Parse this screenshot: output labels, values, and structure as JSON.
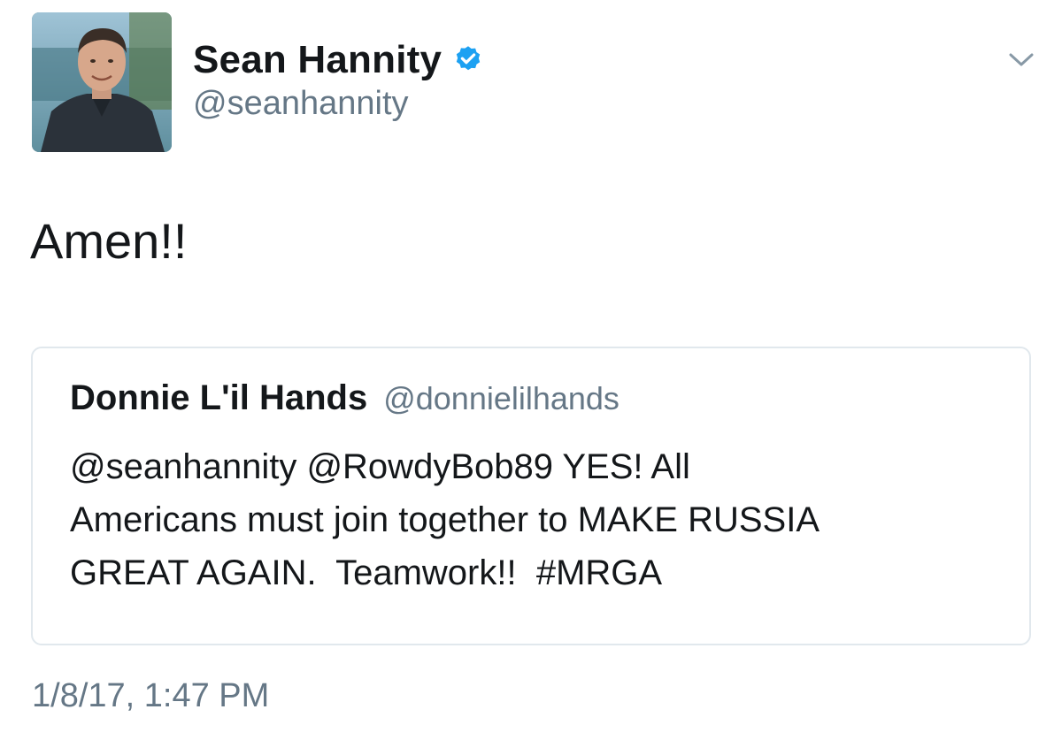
{
  "tweet": {
    "author": {
      "display_name": "Sean Hannity",
      "handle": "@seanhannity",
      "verified": true,
      "avatar_icon": "profile-photo"
    },
    "text": "Amen!!",
    "timestamp": "1/8/17, 1:47 PM",
    "menu_icon": "chevron-down-icon"
  },
  "quoted_tweet": {
    "author": {
      "display_name": "Donnie L'il Hands",
      "handle": "@donnielilhands"
    },
    "text": "@seanhannity @RowdyBob89 YES! All\nAmericans must join together to MAKE RUSSIA\nGREAT AGAIN.  Teamwork!!  #MRGA"
  },
  "colors": {
    "text_primary": "#14171a",
    "text_secondary": "#657786",
    "verified_blue": "#1da1f2",
    "card_border": "#e1e8ed"
  }
}
